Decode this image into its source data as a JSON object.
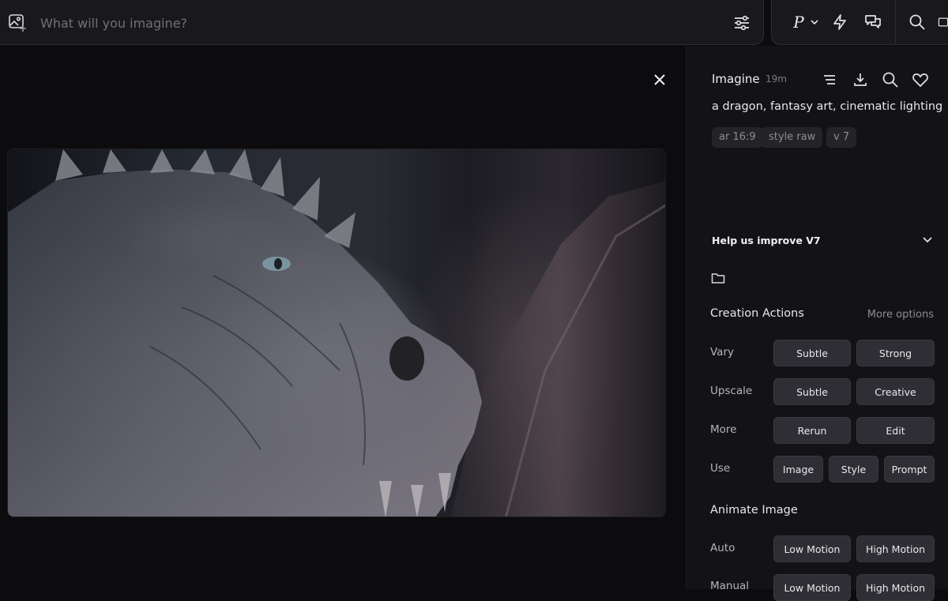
{
  "topbar": {
    "prompt_placeholder": "What will you imagine?",
    "personalize_label": "P"
  },
  "detail": {
    "title": "Imagine",
    "age": "19m",
    "prompt": "a dragon, fantasy art, cinematic lighting",
    "params": [
      "ar 16:9",
      "style raw",
      "v 7"
    ]
  },
  "feedback": {
    "label": "Help us improve V7"
  },
  "creation_actions": {
    "title": "Creation Actions",
    "more_options": "More options",
    "rows": [
      {
        "label": "Vary",
        "buttons": [
          "Subtle",
          "Strong"
        ]
      },
      {
        "label": "Upscale",
        "buttons": [
          "Subtle",
          "Creative"
        ]
      },
      {
        "label": "More",
        "buttons": [
          "Rerun",
          "Edit"
        ]
      },
      {
        "label": "Use",
        "buttons": [
          "Image",
          "Style",
          "Prompt"
        ]
      }
    ]
  },
  "animate": {
    "title": "Animate Image",
    "rows": [
      {
        "label": "Auto",
        "buttons": [
          "Low Motion",
          "High Motion"
        ]
      },
      {
        "label": "Manual",
        "buttons": [
          "Low Motion",
          "High Motion"
        ]
      }
    ]
  },
  "colors": {
    "background": "#0c0c0e",
    "panel": "#131316",
    "button": "#2e2e34",
    "text": "#e8e8ec",
    "muted": "#8c8c96"
  },
  "icons": [
    "image-add-icon",
    "sliders-icon",
    "chevron-down-icon",
    "lightning-icon",
    "chat-icon",
    "search-icon",
    "panel-icon",
    "close-icon",
    "list-icon",
    "download-icon",
    "heart-icon",
    "folder-icon"
  ]
}
